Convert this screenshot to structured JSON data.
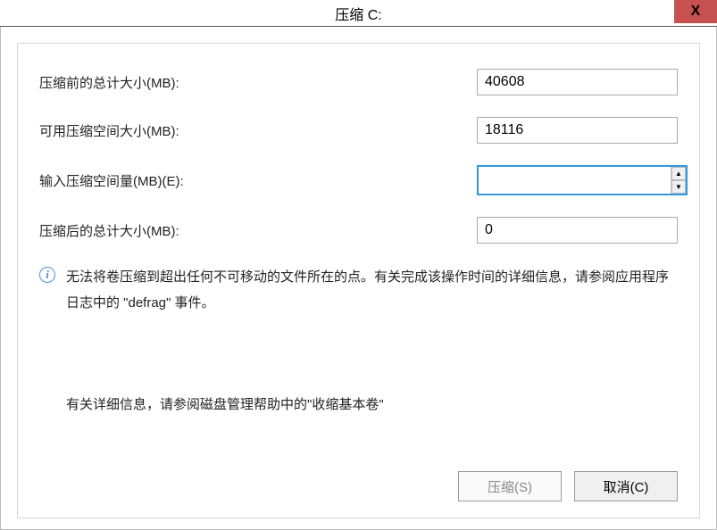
{
  "titlebar": {
    "title": "压缩 C:"
  },
  "fields": {
    "total_before": {
      "label": "压缩前的总计大小(MB):",
      "value": "40608"
    },
    "available": {
      "label": "可用压缩空间大小(MB):",
      "value": "18116"
    },
    "input_amount": {
      "label": "输入压缩空间量(MB)(E):",
      "value": ""
    },
    "total_after": {
      "label": "压缩后的总计大小(MB):",
      "value": "0"
    }
  },
  "info": {
    "text": "无法将卷压缩到超出任何不可移动的文件所在的点。有关完成该操作时间的详细信息，请参阅应用程序日志中的 \"defrag\" 事件。"
  },
  "detail": {
    "text": "有关详细信息，请参阅磁盘管理帮助中的\"收缩基本卷\""
  },
  "buttons": {
    "shrink": "压缩(S)",
    "cancel": "取消(C)"
  }
}
